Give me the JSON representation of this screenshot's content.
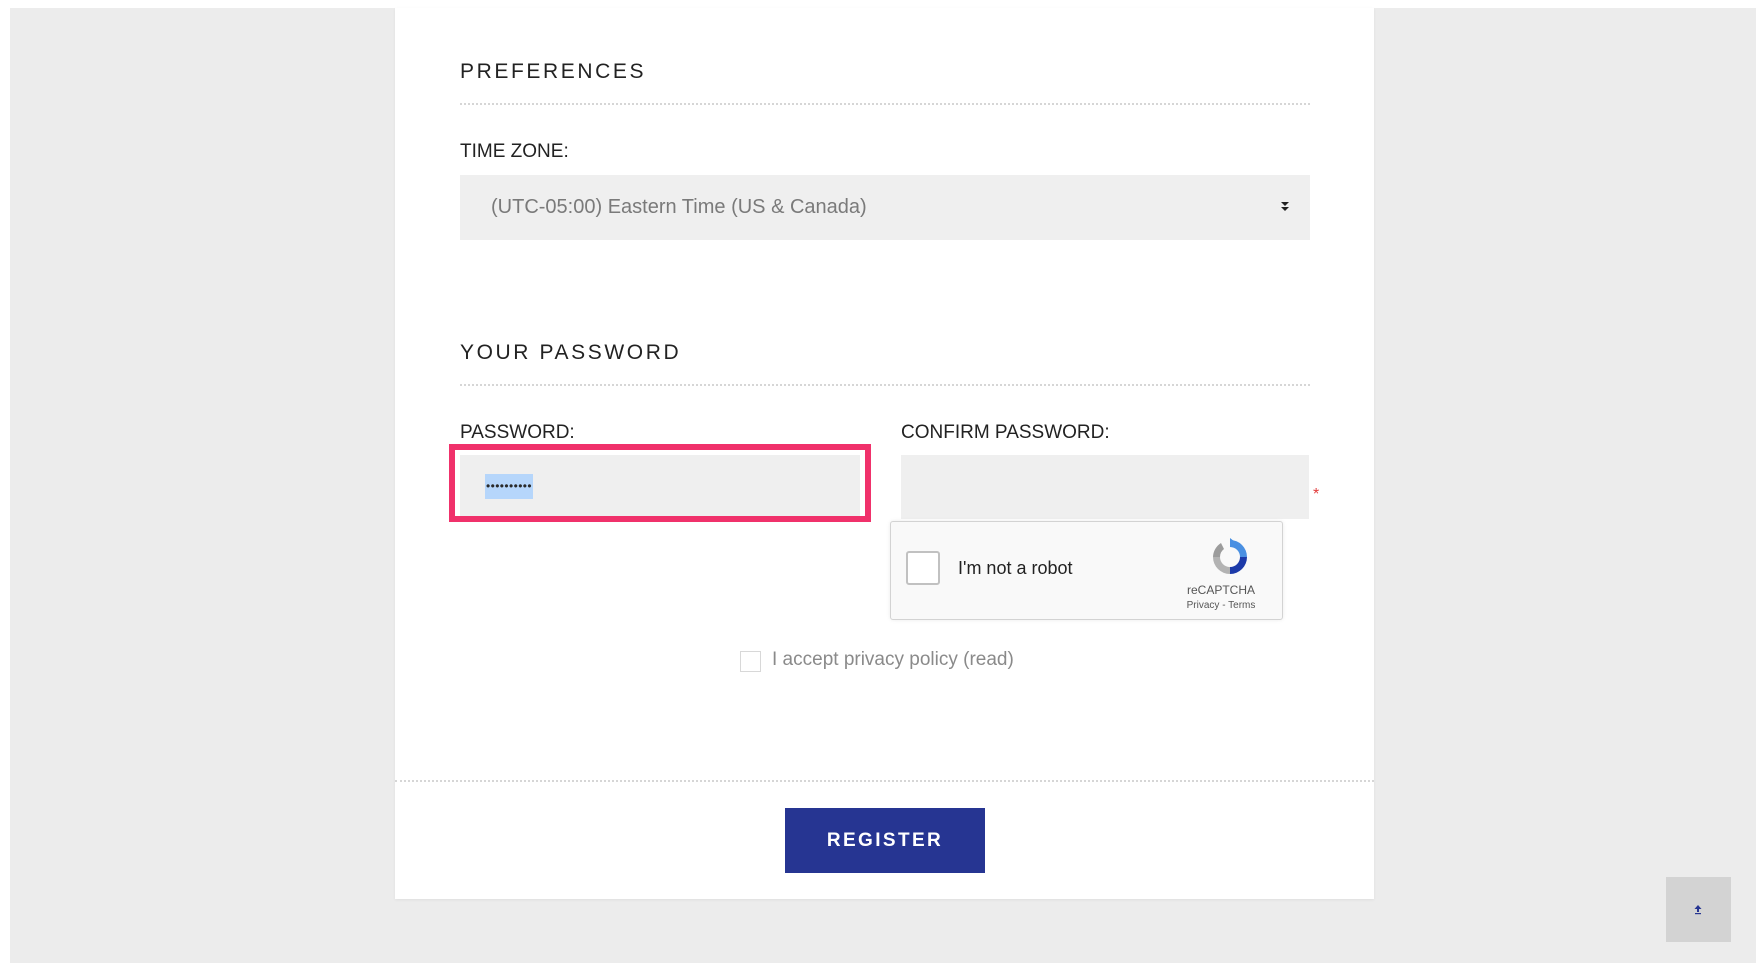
{
  "preferences": {
    "title": "PREFERENCES",
    "timezone_label": "TIME ZONE:",
    "timezone_value": "(UTC-05:00) Eastern Time (US & Canada)"
  },
  "password_section": {
    "title": "YOUR PASSWORD",
    "password_label": "PASSWORD:",
    "password_value_masked": "••••••••••",
    "confirm_label": "CONFIRM PASSWORD:",
    "required_mark": "*"
  },
  "captcha": {
    "label": "I'm not a robot",
    "brand": "reCAPTCHA",
    "links": "Privacy - Terms"
  },
  "privacy": {
    "label": "I accept privacy policy (read)"
  },
  "actions": {
    "register_label": "REGISTER"
  },
  "colors": {
    "primary_button": "#263592",
    "highlight_border": "#f0316b",
    "selection": "#b6d6fb",
    "required": "#e23a3a"
  },
  "icons": {
    "select_arrow": "chevron-down-icon",
    "scroll_top": "arrow-up-icon",
    "captcha_logo": "recaptcha-logo-icon"
  }
}
